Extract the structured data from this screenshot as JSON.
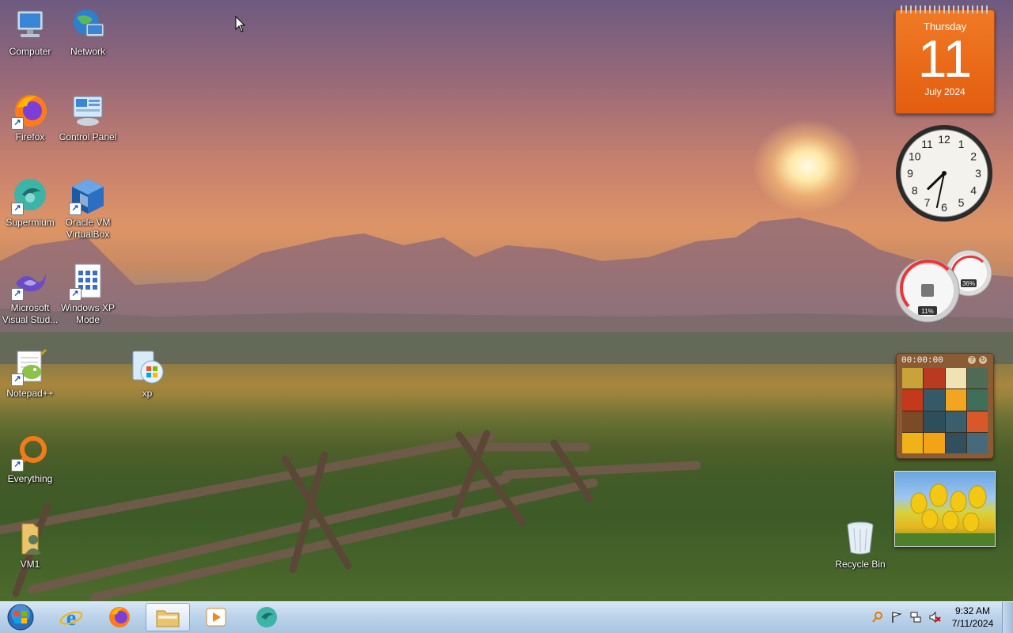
{
  "desktop": {
    "icons": [
      {
        "id": "computer",
        "label": "Computer",
        "icon": "computer-icon"
      },
      {
        "id": "network",
        "label": "Network",
        "icon": "network-icon"
      },
      {
        "id": "firefox",
        "label": "Firefox",
        "icon": "firefox-icon"
      },
      {
        "id": "control-panel",
        "label": "Control Panel",
        "icon": "control-panel-icon"
      },
      {
        "id": "supermium",
        "label": "Supermium",
        "icon": "supermium-icon"
      },
      {
        "id": "virtualbox",
        "label": "Oracle VM VirtualBox",
        "icon": "virtualbox-icon"
      },
      {
        "id": "visual-studio",
        "label": "Microsoft Visual Stud...",
        "icon": "visual-studio-icon"
      },
      {
        "id": "xp-mode",
        "label": "Windows XP Mode",
        "icon": "xp-mode-icon"
      },
      {
        "id": "notepadpp",
        "label": "Notepad++",
        "icon": "notepadpp-icon"
      },
      {
        "id": "xp",
        "label": "xp",
        "icon": "xp-setup-icon"
      },
      {
        "id": "everything",
        "label": "Everything",
        "icon": "everything-icon"
      },
      {
        "id": "vm1",
        "label": "VM1",
        "icon": "folder-user-icon"
      },
      {
        "id": "recycle-bin",
        "label": "Recycle Bin",
        "icon": "recycle-bin-icon"
      }
    ]
  },
  "gadgets": {
    "calendar": {
      "weekday": "Thursday",
      "day": "11",
      "month_year": "July 2024"
    },
    "clock": {
      "hour": 7,
      "minute": 32
    },
    "cpu_meter": {
      "cpu_percent": "11%",
      "memory_percent": "36%"
    },
    "puzzle": {
      "timer": "00:00:00"
    },
    "slideshow": {
      "subject": "yellow tulips"
    }
  },
  "taskbar": {
    "start_icon": "windows-orb-icon",
    "pinned": [
      {
        "id": "ie",
        "icon": "internet-explorer-icon",
        "active": false
      },
      {
        "id": "firefox",
        "icon": "firefox-icon",
        "active": false
      },
      {
        "id": "explorer",
        "icon": "file-explorer-icon",
        "active": true
      },
      {
        "id": "media-player",
        "icon": "media-player-icon",
        "active": false
      },
      {
        "id": "supermium",
        "icon": "supermium-icon",
        "active": false
      }
    ],
    "tray": [
      "search-tray-icon",
      "action-center-flag-icon",
      "network-tray-icon",
      "volume-muted-icon"
    ],
    "time": "9:32 AM",
    "date": "7/11/2024"
  },
  "colors": {
    "taskbar": "#bcd3ea",
    "calendar": "#e35d10"
  }
}
